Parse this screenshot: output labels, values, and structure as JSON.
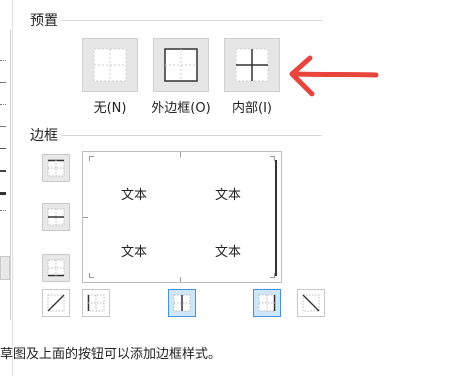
{
  "presets": {
    "title": "预置",
    "buttons": [
      {
        "label": "无(N)",
        "icon": "border-none-icon"
      },
      {
        "label": "外边框(O)",
        "icon": "border-outline-icon"
      },
      {
        "label": "内部(I)",
        "icon": "border-inside-icon"
      }
    ],
    "annotation_color": "#e8453c"
  },
  "border": {
    "title": "边框",
    "preview_cells": [
      "文本",
      "文本",
      "文本",
      "文本"
    ],
    "side_buttons": [
      "border-top-icon",
      "border-middle-horizontal-icon",
      "border-bottom-icon"
    ],
    "bottom_buttons": [
      {
        "icon": "diagonal-up-icon",
        "active": false
      },
      {
        "icon": "border-left-icon",
        "active": false
      },
      {
        "icon": "border-middle-vertical-icon",
        "active": true
      },
      {
        "icon": "border-right-icon",
        "active": true
      },
      {
        "icon": "diagonal-down-icon",
        "active": false
      }
    ],
    "active_color": "#cfe6f7"
  },
  "hint": "草图及上面的按钮可以添加边框样式。"
}
